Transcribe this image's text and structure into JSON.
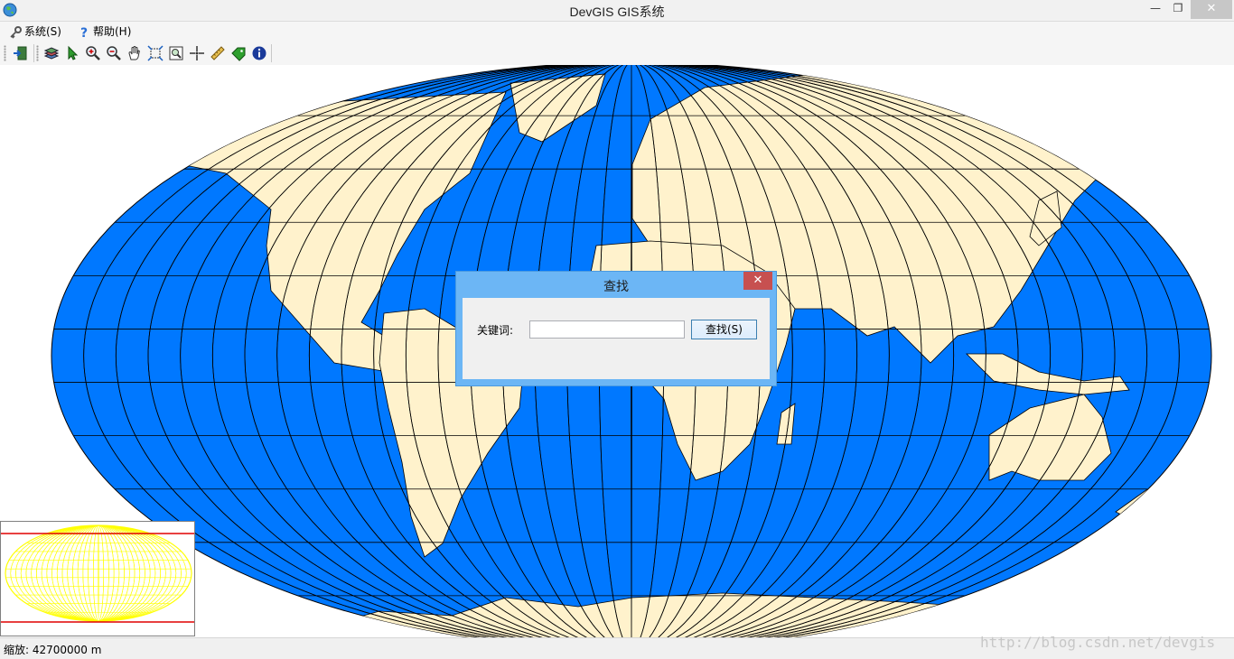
{
  "window": {
    "title": "DevGIS GIS系统",
    "minimize_glyph": "—",
    "maximize_glyph": "❐",
    "close_glyph": "✕"
  },
  "menu": {
    "items": [
      {
        "label": "系统(S)",
        "icon": "key-icon"
      },
      {
        "label": "帮助(H)",
        "icon": "help-icon"
      }
    ]
  },
  "toolbar": {
    "tools": [
      "exit-icon",
      "layers-icon",
      "select-pointer-icon",
      "zoom-in-icon",
      "zoom-out-icon",
      "pan-hand-icon",
      "full-extent-icon",
      "zoom-box-icon",
      "crosshair-icon",
      "measure-ruler-icon",
      "tag-icon",
      "info-icon"
    ]
  },
  "map": {
    "ocean_color": "#0078ff",
    "land_color": "#fff2cc",
    "grid_color": "#000000"
  },
  "overview": {
    "map_color": "#ffff00",
    "extent_color": "#e00000"
  },
  "dialog": {
    "title": "查找",
    "close_glyph": "✕",
    "keyword_label": "关键词:",
    "keyword_value": "",
    "search_button": "查找(S)"
  },
  "status": {
    "scale": "缩放: 42700000 m"
  },
  "watermark": "http://blog.csdn.net/devgis"
}
